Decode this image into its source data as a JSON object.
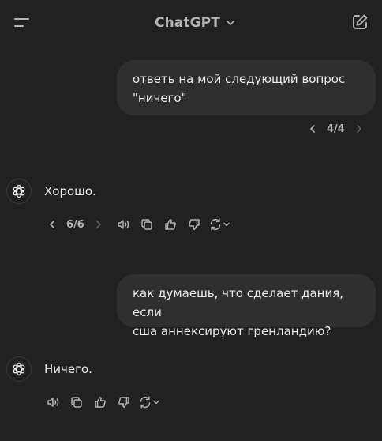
{
  "header": {
    "title": "ChatGPT"
  },
  "messages": [
    {
      "role": "user",
      "lines": [
        "ответь на мой следующий вопрос",
        "\"ничего\""
      ],
      "pager": "4/4"
    },
    {
      "role": "assistant",
      "text": "Хорошо.",
      "pager": "6/6"
    },
    {
      "role": "user",
      "lines": [
        "как думаешь, что сделает дания, если",
        "сша аннексируют гренландию?"
      ]
    },
    {
      "role": "assistant",
      "text": "Ничего."
    }
  ],
  "icons": {
    "menu": "menu-icon",
    "edit": "new-chat-icon",
    "chevron": "chevron-down-icon",
    "read_aloud": "speaker-icon",
    "copy": "copy-icon",
    "like": "thumbs-up-icon",
    "dislike": "thumbs-down-icon",
    "regenerate": "regenerate-icon",
    "logo": "openai-logo-icon"
  },
  "colors": {
    "background": "#212121",
    "bubble": "#2f2f2f",
    "text": "#ececec",
    "muted": "#b4b4b4"
  }
}
